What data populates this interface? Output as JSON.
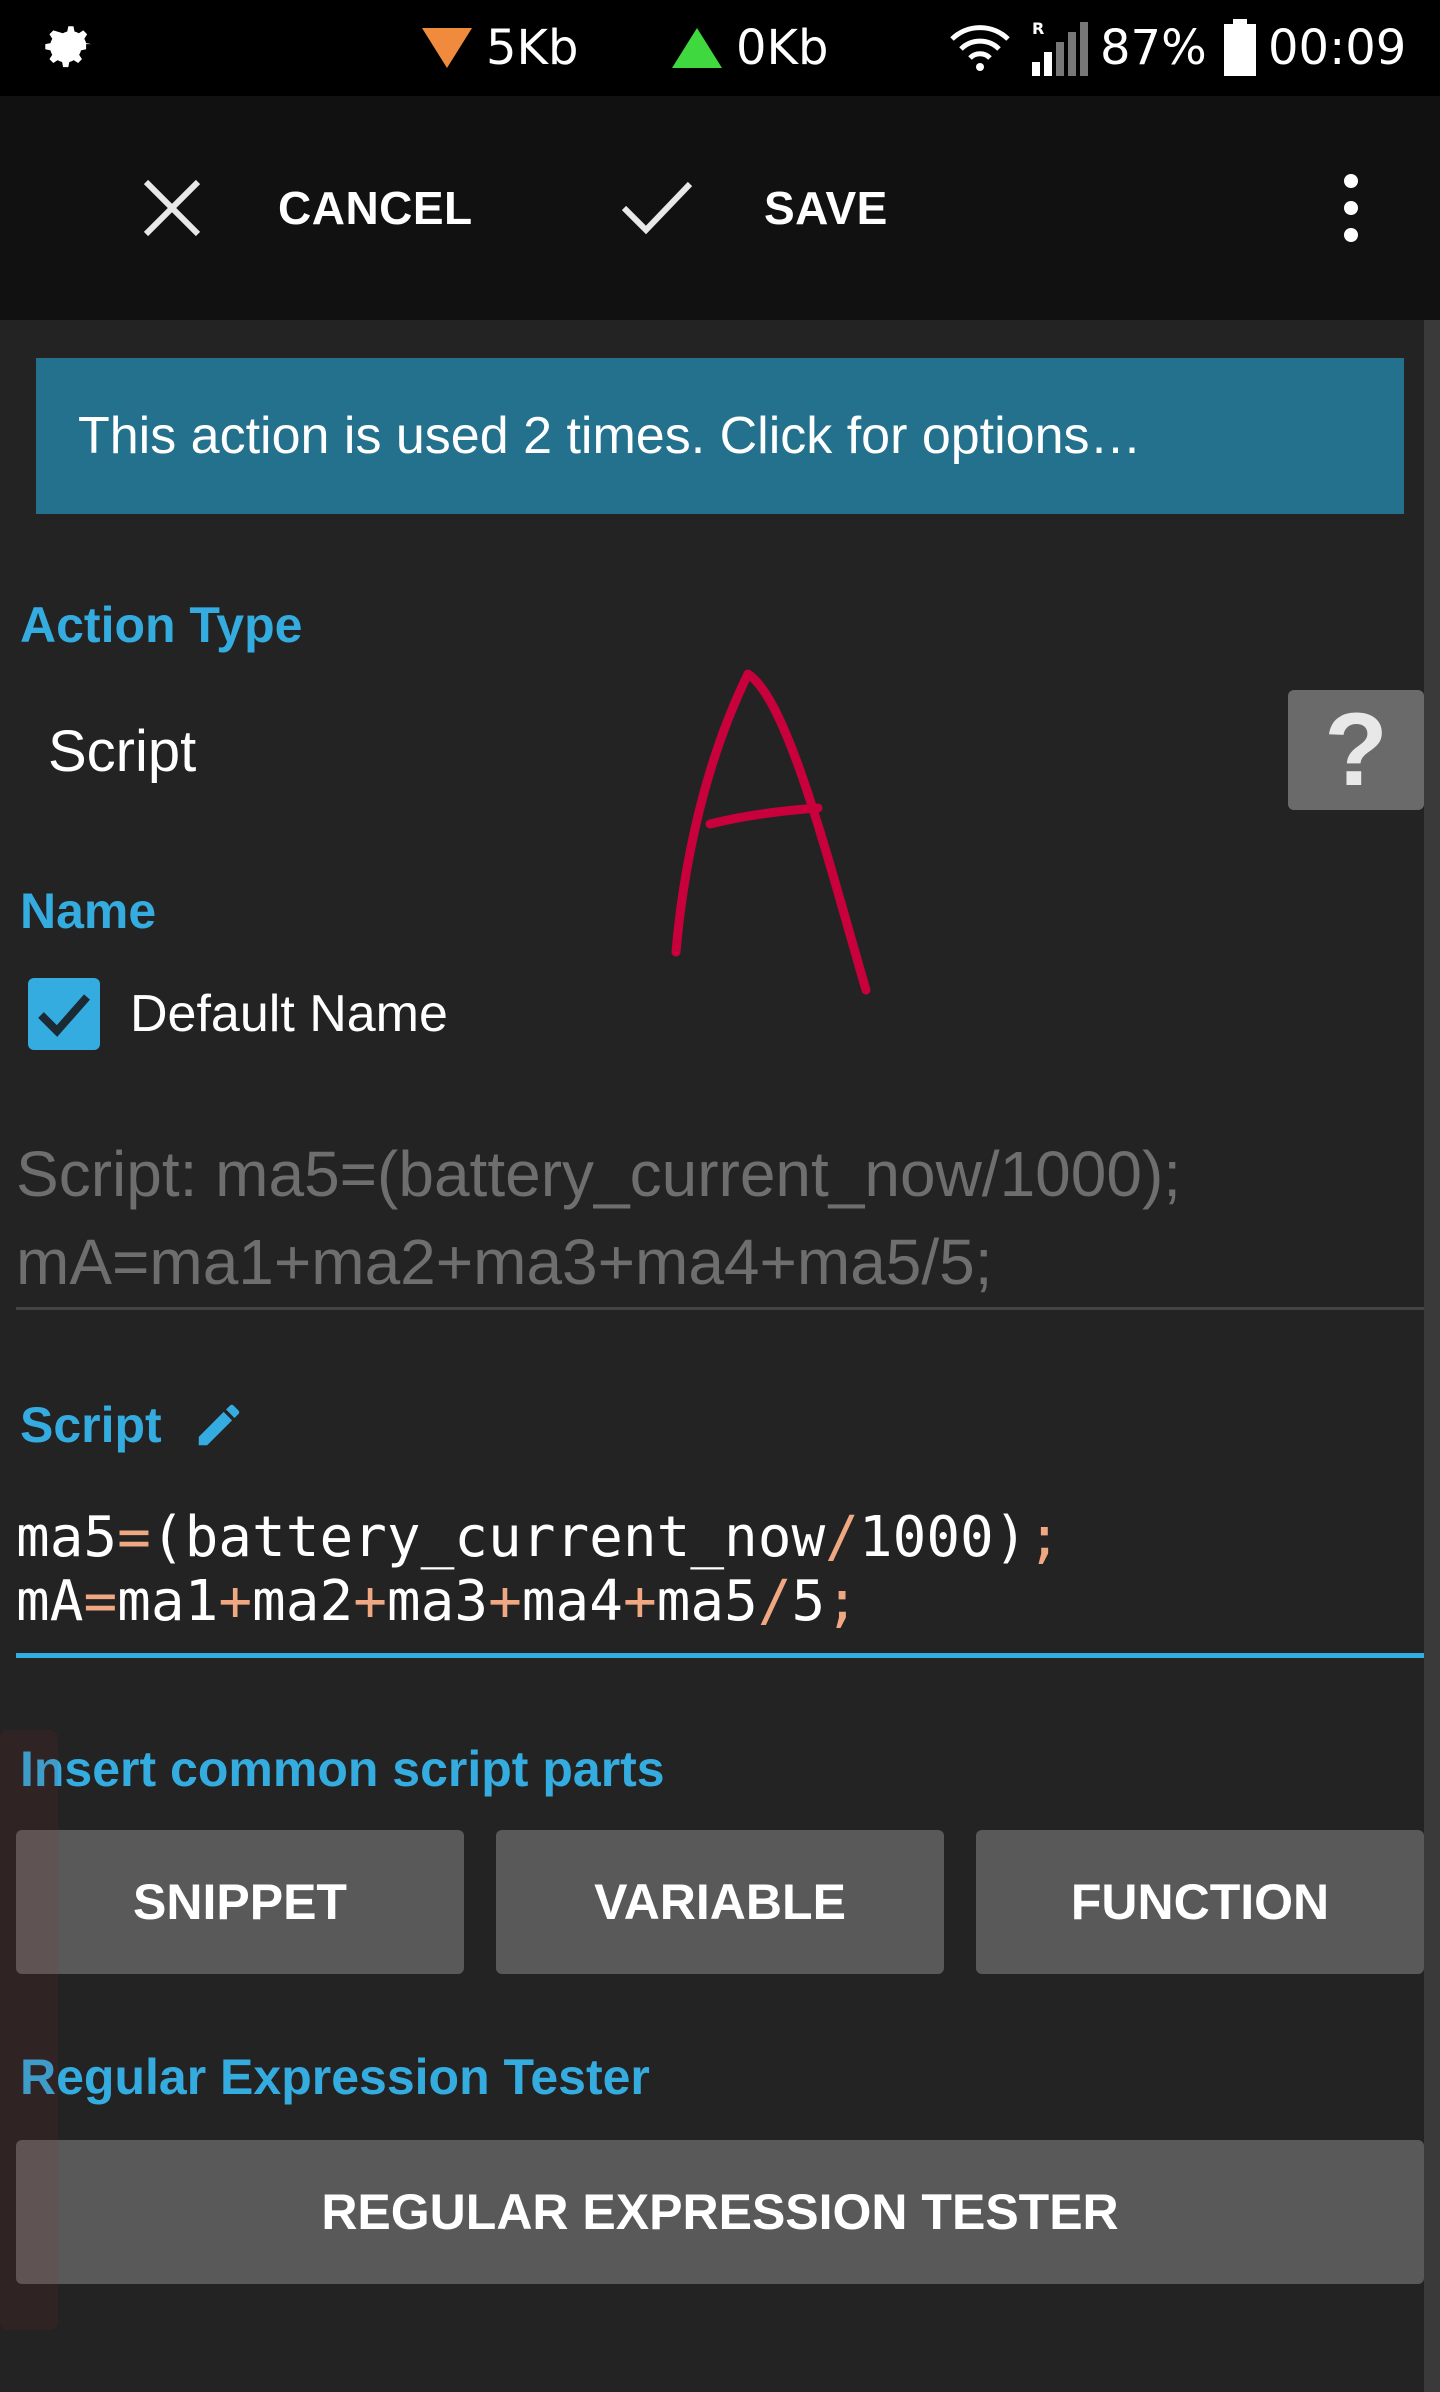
{
  "status_bar": {
    "download_speed": "5Kb",
    "upload_speed": "0Kb",
    "roaming_indicator": "R",
    "battery_percent": "87%",
    "time": "00:09",
    "icons": [
      "gear-icon",
      "download-arrow-icon",
      "upload-arrow-icon",
      "wifi-icon",
      "signal-icon",
      "battery-icon"
    ]
  },
  "toolbar": {
    "cancel_label": "CANCEL",
    "save_label": "SAVE",
    "icons": [
      "close-icon",
      "check-icon",
      "more-vert-icon"
    ]
  },
  "banner": {
    "text": "This action is used 2 times. Click for options…"
  },
  "action_type": {
    "label": "Action Type",
    "value": "Script",
    "help_symbol": "?"
  },
  "name_section": {
    "label": "Name",
    "checkbox_label": "Default Name",
    "checkbox_checked": true,
    "name_line1": "Script: ma5=(battery_current_now/1000);",
    "name_line2": "mA=ma1+ma2+ma3+ma4+ma5/5;"
  },
  "script_section": {
    "label": "Script",
    "code": [
      [
        {
          "t": "ma5",
          "op": false
        },
        {
          "t": "=",
          "op": true
        },
        {
          "t": "(battery_current_now",
          "op": false
        },
        {
          "t": "/",
          "op": true
        },
        {
          "t": "1000)",
          "op": false
        },
        {
          "t": ";",
          "op": true
        }
      ],
      [
        {
          "t": "mA",
          "op": false
        },
        {
          "t": "=",
          "op": true
        },
        {
          "t": "ma1",
          "op": false
        },
        {
          "t": "+",
          "op": true
        },
        {
          "t": "ma2",
          "op": false
        },
        {
          "t": "+",
          "op": true
        },
        {
          "t": "ma3",
          "op": false
        },
        {
          "t": "+",
          "op": true
        },
        {
          "t": "ma4",
          "op": false
        },
        {
          "t": "+",
          "op": true
        },
        {
          "t": "ma5",
          "op": false
        },
        {
          "t": "/",
          "op": true
        },
        {
          "t": "5",
          "op": false
        },
        {
          "t": ";",
          "op": true
        }
      ]
    ]
  },
  "insert_section": {
    "label": "Insert common script parts",
    "snippet_label": "SNIPPET",
    "variable_label": "VARIABLE",
    "function_label": "FUNCTION"
  },
  "regex_section": {
    "label": "Regular Expression Tester",
    "button_label": "REGULAR EXPRESSION TESTER"
  },
  "colors": {
    "accent": "#35ace0",
    "banner": "#23718c",
    "operator": "#f0a882",
    "button": "#595959",
    "handwriting": "#c8003c",
    "background": "#232323"
  }
}
